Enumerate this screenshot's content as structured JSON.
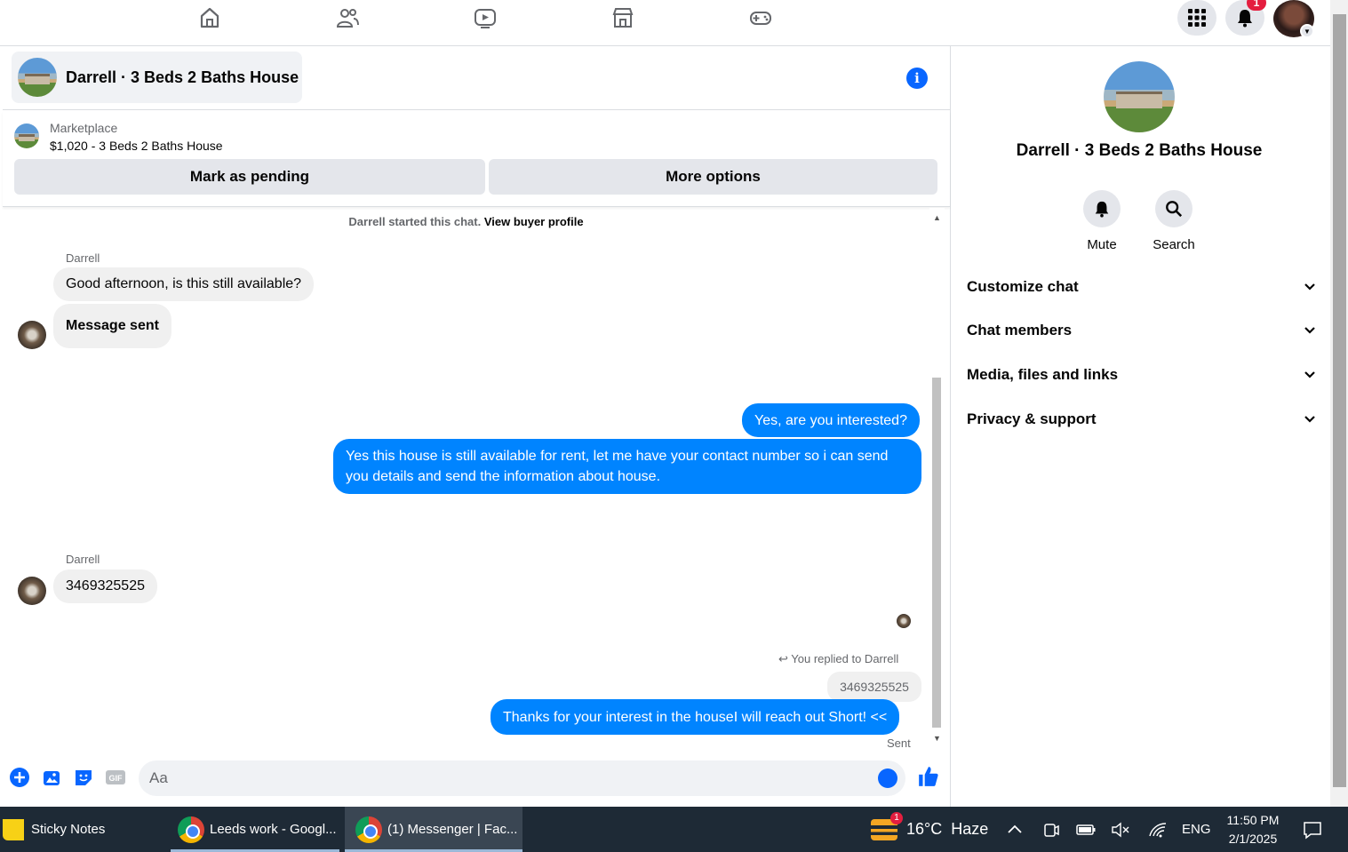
{
  "nav": {
    "icons": [
      "home-icon",
      "friends-icon",
      "watch-icon",
      "marketplace-icon",
      "gaming-icon"
    ],
    "notification_count": "1"
  },
  "chat": {
    "title": "Darrell · 3 Beds 2 Baths House",
    "marketplace_label": "Marketplace",
    "listing": "$1,020 - 3 Beds 2 Baths House",
    "mark_pending": "Mark as pending",
    "more_options": "More options",
    "started_text": "Darrell started this chat.",
    "buyer_profile": "View buyer profile",
    "messages": [
      {
        "sender": "Darrell",
        "text": "Good afternoon, is this still available?"
      },
      {
        "text": "Message sent"
      },
      {
        "text": "Yes, are you interested?"
      },
      {
        "text": "Yes this house is still available for rent, let me have your contact number so i can send you details and send the information about house."
      },
      {
        "sender": "Darrell",
        "text": "3469325525"
      },
      {
        "text": "Thanks for your interest in the houseI will reach out Short! <<"
      }
    ],
    "replied_to": "You replied to Darrell",
    "quoted_text": "3469325525",
    "sent_status": "Sent",
    "composer_placeholder": "Aa",
    "colors": {
      "accent": "#0084ff",
      "incoming": "#f0f0f0"
    }
  },
  "info_panel": {
    "name": "Darrell · 3 Beds 2 Baths House",
    "mute": "Mute",
    "search": "Search",
    "sections": [
      "Customize chat",
      "Chat members",
      "Media, files and links",
      "Privacy & support"
    ]
  },
  "taskbar": {
    "apps": [
      "Sticky Notes",
      "Leeds work - Googl...",
      "(1) Messenger | Fac..."
    ],
    "weather": "16°C  Haze",
    "weather_badge": "1",
    "lang": "ENG",
    "time": "11:50 PM",
    "date": "2/1/2025"
  }
}
